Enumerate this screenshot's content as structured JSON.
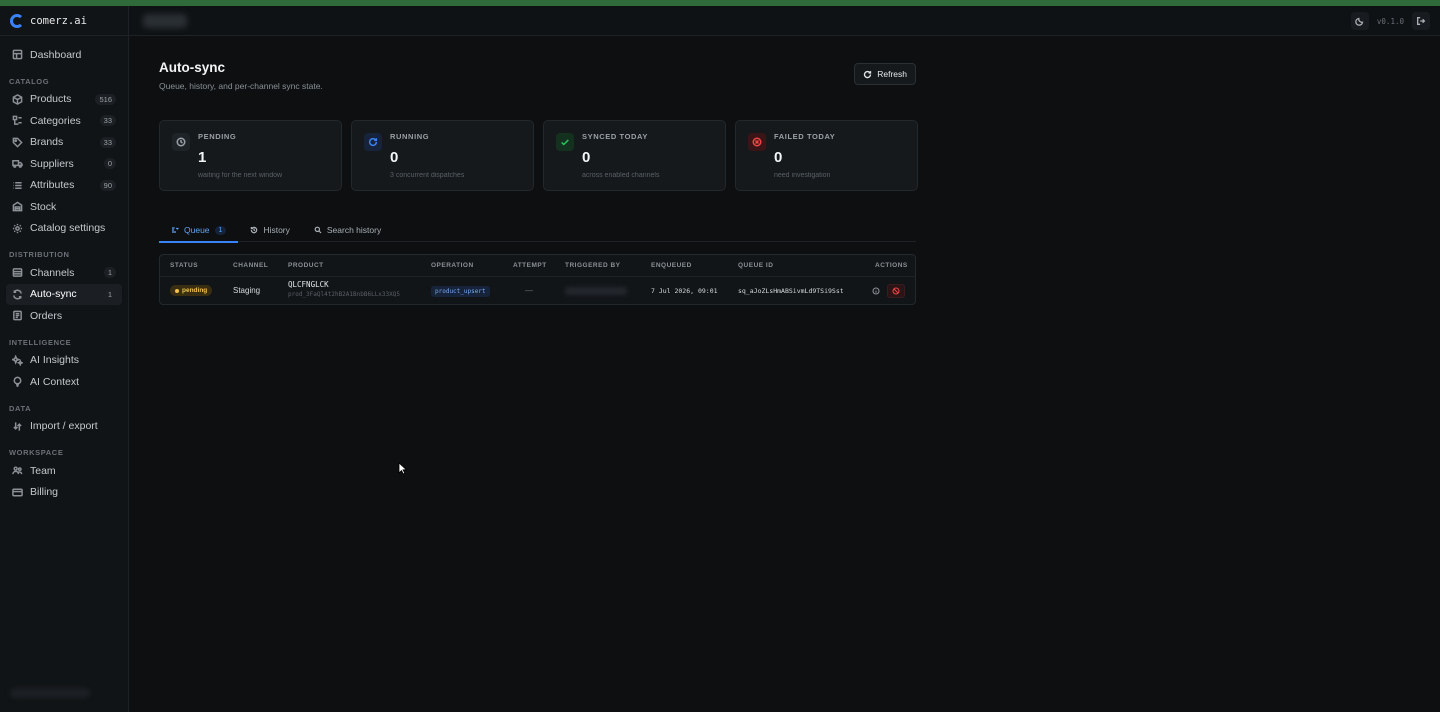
{
  "brand": {
    "name": "comerz.ai"
  },
  "header": {
    "version": "v0.1.0"
  },
  "sidebar": {
    "top": [
      {
        "label": "Dashboard",
        "icon": "dashboard-icon"
      }
    ],
    "sections": [
      {
        "title": "CATALOG",
        "items": [
          {
            "label": "Products",
            "count": "516",
            "icon": "box-icon"
          },
          {
            "label": "Categories",
            "count": "33",
            "icon": "categories-icon"
          },
          {
            "label": "Brands",
            "count": "33",
            "icon": "tag-icon"
          },
          {
            "label": "Suppliers",
            "count": "0",
            "icon": "truck-icon"
          },
          {
            "label": "Attributes",
            "count": "90",
            "icon": "list-icon"
          },
          {
            "label": "Stock",
            "count": "",
            "icon": "warehouse-icon"
          },
          {
            "label": "Catalog settings",
            "count": "",
            "icon": "gear-icon"
          }
        ]
      },
      {
        "title": "DISTRIBUTION",
        "items": [
          {
            "label": "Channels",
            "count": "1",
            "icon": "channels-icon"
          },
          {
            "label": "Auto-sync",
            "count": "1",
            "icon": "sync-icon",
            "active": true
          },
          {
            "label": "Orders",
            "count": "",
            "icon": "orders-icon"
          }
        ]
      },
      {
        "title": "INTELLIGENCE",
        "items": [
          {
            "label": "AI Insights",
            "count": "",
            "icon": "sparkle-icon"
          },
          {
            "label": "AI Context",
            "count": "",
            "icon": "context-icon"
          }
        ]
      },
      {
        "title": "DATA",
        "items": [
          {
            "label": "Import / export",
            "count": "",
            "icon": "import-export-icon"
          }
        ]
      },
      {
        "title": "WORKSPACE",
        "items": [
          {
            "label": "Team",
            "count": "",
            "icon": "team-icon"
          },
          {
            "label": "Billing",
            "count": "",
            "icon": "billing-icon"
          }
        ]
      }
    ]
  },
  "page": {
    "title": "Auto-sync",
    "subtitle": "Queue, history, and per-channel sync state.",
    "refresh_label": "Refresh"
  },
  "cards": [
    {
      "label": "PENDING",
      "value": "1",
      "sub": "waiting for the next window",
      "icon": "clock-icon",
      "color": "#9aa0a6",
      "bg": "#1e2327"
    },
    {
      "label": "RUNNING",
      "value": "0",
      "sub": "3 concurrent dispatches",
      "icon": "spinner-icon",
      "color": "#3b82f6",
      "bg": "#16233a"
    },
    {
      "label": "SYNCED TODAY",
      "value": "0",
      "sub": "across enabled channels",
      "icon": "check-icon",
      "color": "#22c55e",
      "bg": "#14301f"
    },
    {
      "label": "FAILED TODAY",
      "value": "0",
      "sub": "need investigation",
      "icon": "x-circle-icon",
      "color": "#ef4444",
      "bg": "#3a1518"
    }
  ],
  "tabs": [
    {
      "label": "Queue",
      "count": "1",
      "icon": "queue-icon",
      "active": true
    },
    {
      "label": "History",
      "count": "",
      "icon": "history-icon"
    },
    {
      "label": "Search history",
      "count": "",
      "icon": "search-icon"
    }
  ],
  "table": {
    "columns": [
      "STATUS",
      "CHANNEL",
      "PRODUCT",
      "OPERATION",
      "ATTEMPT",
      "TRIGGERED BY",
      "ENQUEUED",
      "QUEUE ID",
      "ACTIONS"
    ],
    "rows": [
      {
        "status": "pending",
        "channel": "Staging",
        "product_name": "QLCFNGLCK",
        "product_id": "prod_3FaQl4t2hB2A1BnbB6LLx33XQ5",
        "operation": "product_upsert",
        "attempt": "—",
        "enqueued": "7 Jul 2026, 09:01",
        "queue_id": "sq_aJoZLsHmABSivmLd9TSi9Sst"
      }
    ]
  }
}
